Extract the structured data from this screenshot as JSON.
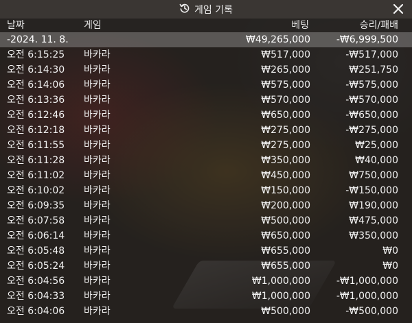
{
  "header": {
    "title": "게임 기록"
  },
  "columns": {
    "date": "날짜",
    "game": "게임",
    "bet": "베팅",
    "result": "승리/패배"
  },
  "summary": {
    "date": "-2024. 11. 8.",
    "bet": "₩49,265,000",
    "result": "-₩6,999,500"
  },
  "rows": [
    {
      "time": "오전 6:15:25",
      "game": "바카라",
      "bet": "₩517,000",
      "result": "-₩517,000"
    },
    {
      "time": "오전 6:14:30",
      "game": "바카라",
      "bet": "₩265,000",
      "result": "₩251,750"
    },
    {
      "time": "오전 6:14:06",
      "game": "바카라",
      "bet": "₩575,000",
      "result": "-₩575,000"
    },
    {
      "time": "오전 6:13:36",
      "game": "바카라",
      "bet": "₩570,000",
      "result": "-₩570,000"
    },
    {
      "time": "오전 6:12:46",
      "game": "바카라",
      "bet": "₩650,000",
      "result": "-₩650,000"
    },
    {
      "time": "오전 6:12:18",
      "game": "바카라",
      "bet": "₩275,000",
      "result": "-₩275,000"
    },
    {
      "time": "오전 6:11:55",
      "game": "바카라",
      "bet": "₩275,000",
      "result": "₩25,000"
    },
    {
      "time": "오전 6:11:28",
      "game": "바카라",
      "bet": "₩350,000",
      "result": "₩40,000"
    },
    {
      "time": "오전 6:11:02",
      "game": "바카라",
      "bet": "₩450,000",
      "result": "₩750,000"
    },
    {
      "time": "오전 6:10:02",
      "game": "바카라",
      "bet": "₩150,000",
      "result": "-₩150,000"
    },
    {
      "time": "오전 6:09:35",
      "game": "바카라",
      "bet": "₩200,000",
      "result": "₩190,000"
    },
    {
      "time": "오전 6:07:58",
      "game": "바카라",
      "bet": "₩500,000",
      "result": "₩475,000"
    },
    {
      "time": "오전 6:06:14",
      "game": "바카라",
      "bet": "₩650,000",
      "result": "₩350,000"
    },
    {
      "time": "오전 6:05:48",
      "game": "바카라",
      "bet": "₩655,000",
      "result": "₩0"
    },
    {
      "time": "오전 6:05:24",
      "game": "바카라",
      "bet": "₩655,000",
      "result": "₩0"
    },
    {
      "time": "오전 6:04:56",
      "game": "바카라",
      "bet": "₩1,000,000",
      "result": "-₩1,000,000"
    },
    {
      "time": "오전 6:04:33",
      "game": "바카라",
      "bet": "₩1,000,000",
      "result": "-₩1,000,000"
    },
    {
      "time": "오전 6:04:06",
      "game": "바카라",
      "bet": "₩500,000",
      "result": "-₩500,000"
    }
  ]
}
